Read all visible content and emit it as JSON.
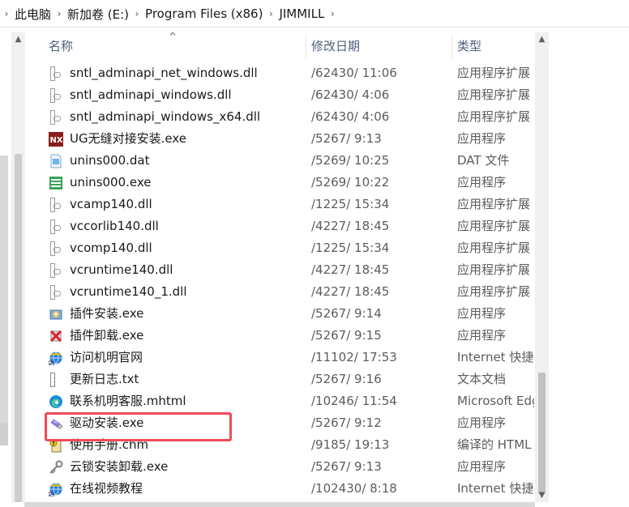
{
  "breadcrumb": [
    "此电脑",
    "新加卷 (E:)",
    "Program Files (x86)",
    "JIMMILL"
  ],
  "columns": {
    "name": "名称",
    "date": "修改日期",
    "type": "类型"
  },
  "files": [
    {
      "name": "sntl_adminapi_net_windows.dll",
      "date": "/62430/ 11:06",
      "type": "应用程序扩展",
      "icon": "dll-file-icon"
    },
    {
      "name": "sntl_adminapi_windows.dll",
      "date": "/62430/ 4:06",
      "type": "应用程序扩展",
      "icon": "dll-file-icon"
    },
    {
      "name": "sntl_adminapi_windows_x64.dll",
      "date": "/62430/ 4:06",
      "type": "应用程序扩展",
      "icon": "dll-file-icon"
    },
    {
      "name": "UG无缝对接安装.exe",
      "date": "/5267/ 9:13",
      "type": "应用程序",
      "icon": "ug-installer-icon"
    },
    {
      "name": "unins000.dat",
      "date": "/5269/ 10:25",
      "type": "DAT 文件",
      "icon": "dat-file-icon"
    },
    {
      "name": "unins000.exe",
      "date": "/5269/ 10:22",
      "type": "应用程序",
      "icon": "uninstaller-icon"
    },
    {
      "name": "vcamp140.dll",
      "date": "/1225/ 15:34",
      "type": "应用程序扩展",
      "icon": "dll-file-icon"
    },
    {
      "name": "vccorlib140.dll",
      "date": "/4227/ 18:45",
      "type": "应用程序扩展",
      "icon": "dll-file-icon"
    },
    {
      "name": "vcomp140.dll",
      "date": "/1225/ 15:34",
      "type": "应用程序扩展",
      "icon": "dll-file-icon"
    },
    {
      "name": "vcruntime140.dll",
      "date": "/4227/ 18:45",
      "type": "应用程序扩展",
      "icon": "dll-file-icon"
    },
    {
      "name": "vcruntime140_1.dll",
      "date": "/4227/ 18:45",
      "type": "应用程序扩展",
      "icon": "dll-file-icon"
    },
    {
      "name": "插件安装.exe",
      "date": "/5267/ 9:14",
      "type": "应用程序",
      "icon": "plugin-install-icon"
    },
    {
      "name": "插件卸载.exe",
      "date": "/5267/ 9:15",
      "type": "应用程序",
      "icon": "plugin-uninstall-icon"
    },
    {
      "name": "访问机明官网",
      "date": "/11102/ 17:53",
      "type": "Internet 快捷方式",
      "icon": "internet-shortcut-icon"
    },
    {
      "name": "更新日志.txt",
      "date": "/5267/ 9:16",
      "type": "文本文档",
      "icon": "text-file-icon"
    },
    {
      "name": "联系机明客服.mhtml",
      "date": "/10246/ 11:54",
      "type": "Microsoft Edge",
      "icon": "edge-icon"
    },
    {
      "name": "驱动安装.exe",
      "date": "/5267/ 9:12",
      "type": "应用程序",
      "icon": "usb-driver-icon"
    },
    {
      "name": "使用手册.chm",
      "date": "/9185/ 19:13",
      "type": "编译的 HTML",
      "icon": "chm-help-icon"
    },
    {
      "name": "云锁安装卸载.exe",
      "date": "/5267/ 9:13",
      "type": "应用程序",
      "icon": "key-icon"
    },
    {
      "name": "在线视频教程",
      "date": "/102430/ 8:18",
      "type": "Internet 快捷方式",
      "icon": "internet-shortcut-icon"
    }
  ],
  "colors": {
    "highlight": "#f04a5a",
    "header_text": "#4c607a"
  }
}
